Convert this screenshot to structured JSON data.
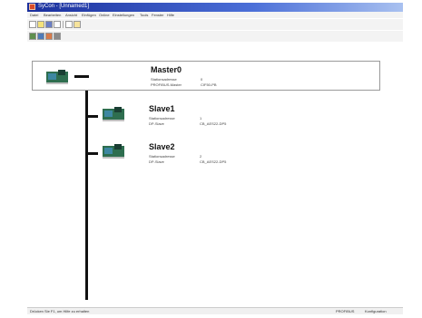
{
  "window": {
    "title": "SyCon - [Unnamed1]"
  },
  "menu": [
    "Datei",
    "Bearbeiten",
    "Ansicht",
    "Einfügen",
    "Online",
    "Einstellungen",
    "Tools",
    "Fenster",
    "Hilfe"
  ],
  "devices": {
    "master": {
      "name": "Master0",
      "prop1_label": "Stationsadresse",
      "prop1_value": "0",
      "prop2_label": "PROFIBUS-Master",
      "prop2_value": "CIF50-PB"
    },
    "slave1": {
      "name": "Slave1",
      "prop1_label": "Stationsadresse",
      "prop1_value": "1",
      "prop2_label": "DP-Slave",
      "prop2_value": "CB_AES22-DP5"
    },
    "slave2": {
      "name": "Slave2",
      "prop1_label": "Stationsadresse",
      "prop1_value": "2",
      "prop2_label": "DP-Slave",
      "prop2_value": "CB_AES22-DP5"
    }
  },
  "statusbar": {
    "left": "Drücken Sie F1, um Hilfe zu erhalten",
    "right1": "PROFIBUS",
    "right2": "Konfiguration"
  }
}
